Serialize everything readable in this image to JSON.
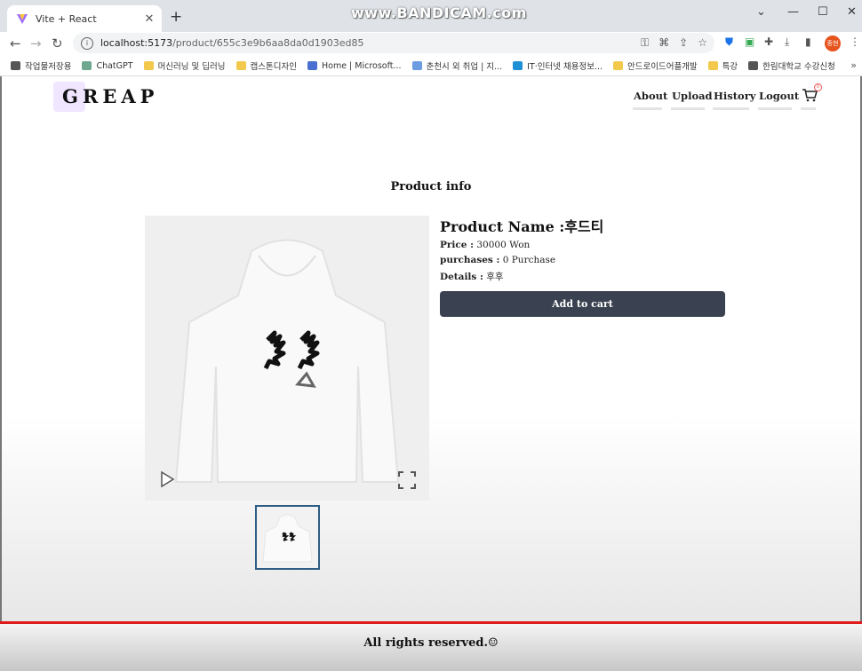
{
  "browser": {
    "tab_title": "Vite + React",
    "watermark": "www.BANDICAM.com",
    "url_host": "localhost:5173",
    "url_path": "/product/655c3e9b6aa8da0d1903ed85",
    "profile_label": "종현",
    "bookmarks": [
      {
        "label": "작업물저장용",
        "color": "#555555"
      },
      {
        "label": "ChatGPT",
        "color": "#6fa88f"
      },
      {
        "label": "머신러닝 및 딥러닝",
        "color": "#f2c94c"
      },
      {
        "label": "캡스톤디자인",
        "color": "#f2c94c"
      },
      {
        "label": "Home | Microsoft...",
        "color": "#4a6fd1"
      },
      {
        "label": "춘천시 외 취업 | 지...",
        "color": "#6b9be0"
      },
      {
        "label": "IT·인터넷 채용정보...",
        "color": "#1f8fd6"
      },
      {
        "label": "안드로이드어플개발",
        "color": "#f2c94c"
      },
      {
        "label": "특강",
        "color": "#f2c94c"
      },
      {
        "label": "한림대학교 수강신청",
        "color": "#555555"
      }
    ]
  },
  "header": {
    "logo": "GREAP",
    "nav": [
      "About",
      "Upload",
      "History",
      "Logout"
    ],
    "cart_count": "0"
  },
  "product": {
    "section_title": "Product info",
    "name_label": "Product Name :",
    "name_value": "후드티",
    "price_label": "Price :",
    "price_value": "30000 Won",
    "purchases_label": "purchases :",
    "purchases_value": "0 Purchase",
    "details_label": "Details :",
    "details_value": "후후",
    "add_to_cart": "Add to cart"
  },
  "footer": {
    "text": "All rights reserved.☺"
  }
}
